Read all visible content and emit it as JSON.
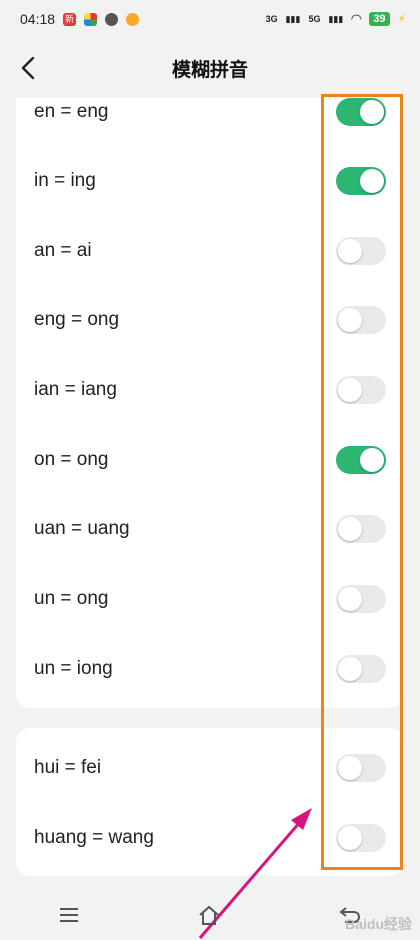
{
  "status": {
    "time": "04:18",
    "net1": "3G",
    "net2": "5G",
    "battery": "39"
  },
  "header": {
    "title": "模糊拼音"
  },
  "group1": [
    {
      "label": "en = eng",
      "on": true
    },
    {
      "label": "in = ing",
      "on": true
    },
    {
      "label": "an = ai",
      "on": false
    },
    {
      "label": "eng = ong",
      "on": false
    },
    {
      "label": "ian = iang",
      "on": false
    },
    {
      "label": "on = ong",
      "on": true
    },
    {
      "label": "uan = uang",
      "on": false
    },
    {
      "label": "un = ong",
      "on": false
    },
    {
      "label": "un = iong",
      "on": false
    }
  ],
  "group2": [
    {
      "label": "hui = fei",
      "on": false
    },
    {
      "label": "huang = wang",
      "on": false
    }
  ],
  "colors": {
    "toggle_on": "#2bb673",
    "toggle_off": "#e9e9e9",
    "annotation_box": "#e8841a",
    "annotation_arrow": "#d6157a"
  },
  "watermark": "Baidu经验"
}
